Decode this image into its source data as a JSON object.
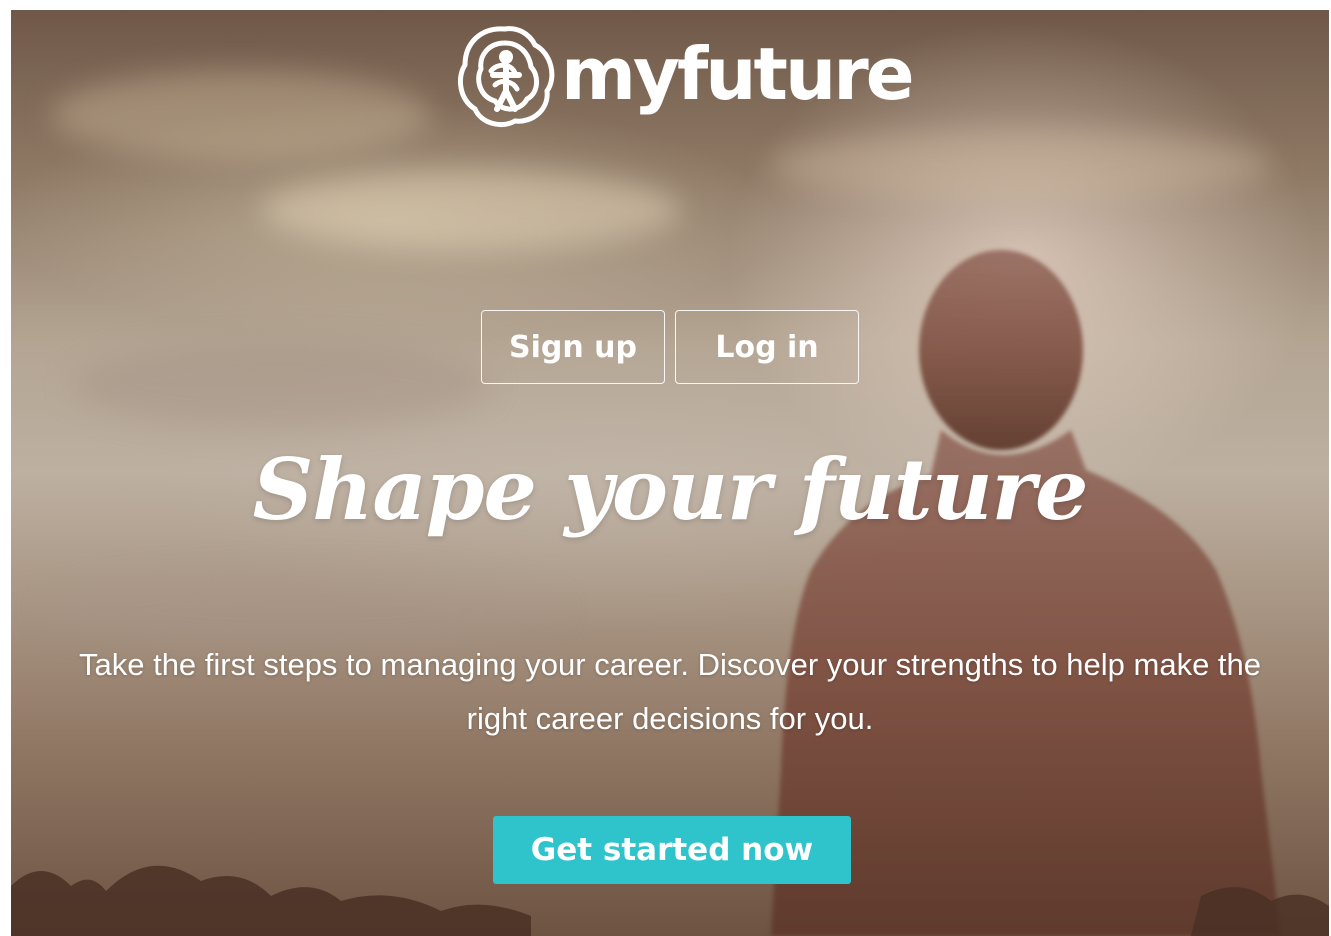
{
  "brand": {
    "name": "myfuture",
    "icon": "logo-mark-icon"
  },
  "auth": {
    "signup_label": "Sign up",
    "login_label": "Log in"
  },
  "hero": {
    "headline": "Shape your future",
    "tagline": "Take the first steps to managing your career. Discover your strengths to help make the right career decisions for you.",
    "cta_label": "Get started now"
  },
  "colors": {
    "accent": "#2fc3cc",
    "text": "#ffffff"
  }
}
